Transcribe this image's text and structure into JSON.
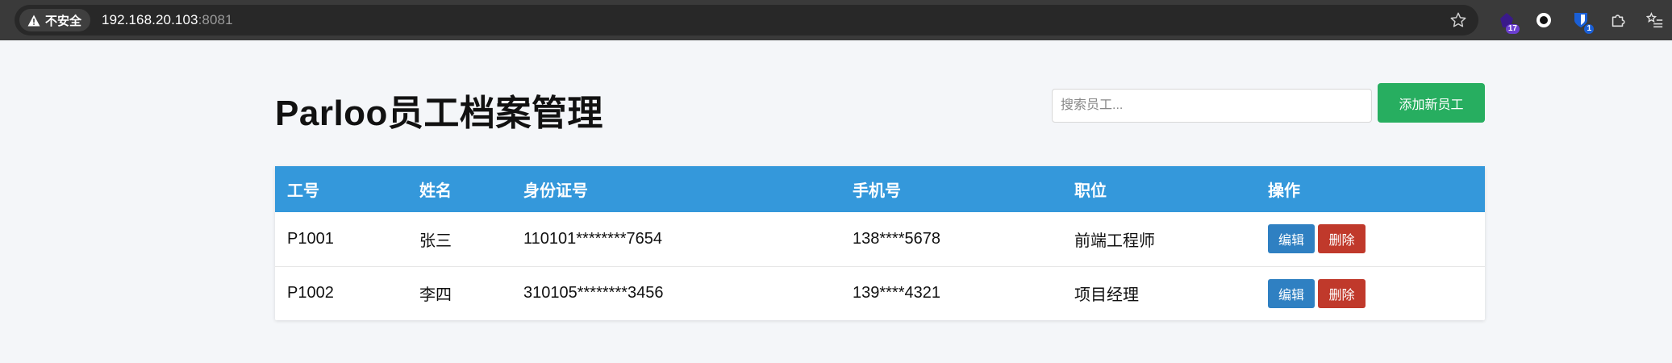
{
  "browser": {
    "security_label": "不安全",
    "url_host": "192.168.20.103",
    "url_port": ":8081",
    "extensions": [
      {
        "icon": "purple-extension-icon",
        "badge": "17"
      },
      {
        "icon": "circle-extension-icon",
        "badge": ""
      },
      {
        "icon": "bitwarden-extension-icon",
        "badge": "1"
      },
      {
        "icon": "puzzle-icon",
        "badge": ""
      },
      {
        "icon": "reading-list-icon",
        "badge": ""
      }
    ]
  },
  "header": {
    "title": "Parloo员工档案管理",
    "search_placeholder": "搜索员工...",
    "add_button_label": "添加新员工"
  },
  "table": {
    "columns": [
      "工号",
      "姓名",
      "身份证号",
      "手机号",
      "职位",
      "操作"
    ],
    "rows": [
      {
        "id": "P1001",
        "name": "张三",
        "id_card": "110101********7654",
        "phone": "138****5678",
        "position": "前端工程师",
        "edit": "编辑",
        "delete": "删除"
      },
      {
        "id": "P1002",
        "name": "李四",
        "id_card": "310105********3456",
        "phone": "139****4321",
        "position": "项目经理",
        "edit": "编辑",
        "delete": "删除"
      }
    ]
  },
  "colors": {
    "header_blue": "#3498db",
    "add_green": "#27ae60",
    "edit_blue": "#2f80c2",
    "delete_red": "#c0392b"
  }
}
